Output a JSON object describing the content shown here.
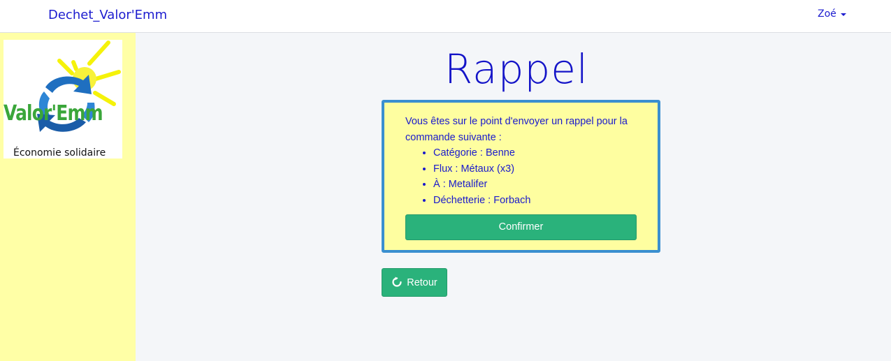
{
  "navbar": {
    "brand": "Dechet_Valor'Emm",
    "user": "Zoé"
  },
  "sidebar": {
    "logo_text": "Valor'Emm",
    "logo_subtitle": "Économie solidaire"
  },
  "main": {
    "title": "Rappel",
    "message": "Vous êtes sur le point d'envoyer un rappel pour la commande suivante :",
    "details": [
      "Catégorie : Benne",
      "Flux : Métaux (x3)",
      "À : Metalifer",
      "Déchetterie : Forbach"
    ],
    "confirm_label": "Confirmer",
    "back_label": "Retour"
  },
  "colors": {
    "brand_text": "#1c1ccf",
    "sidebar_bg": "#ffffa6",
    "alert_bg": "#fefea0",
    "alert_border": "#3a8fd0",
    "button_green": "#2ab27b"
  },
  "icons": {
    "user_dropdown": "caret-down-icon",
    "back": "refresh-icon"
  }
}
